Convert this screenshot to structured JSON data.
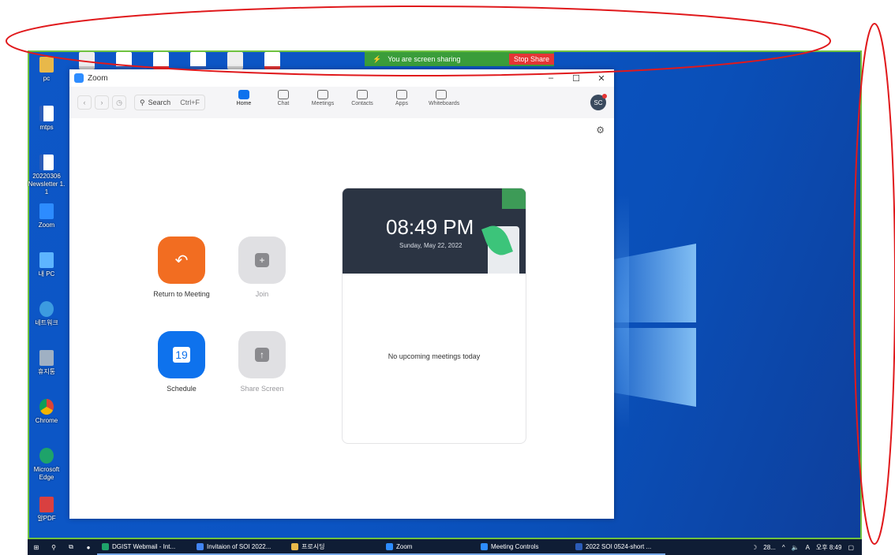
{
  "desktop_icons": [
    {
      "label": "pc",
      "icon": "folder-icon",
      "type": "folder"
    },
    {
      "label": "mtps",
      "icon": "word-document-icon",
      "type": "doc"
    },
    {
      "label": "20220306\nNewsletter 1. 1",
      "icon": "word-document-icon",
      "type": "doc"
    },
    {
      "label": "Zoom",
      "icon": "zoom-icon",
      "type": "zoom"
    },
    {
      "label": "내 PC",
      "icon": "computer-icon",
      "type": "pc"
    },
    {
      "label": "네트워크",
      "icon": "network-icon",
      "type": "net"
    },
    {
      "label": "휴지통",
      "icon": "recycle-bin-icon",
      "type": "bin"
    },
    {
      "label": "Chrome",
      "icon": "chrome-icon",
      "type": "chrome"
    },
    {
      "label": "Microsoft Edge",
      "icon": "edge-icon",
      "type": "edge"
    },
    {
      "label": "알PDF",
      "icon": "pdf-app-icon",
      "type": "app"
    }
  ],
  "share_bar": {
    "text": "You are screen sharing",
    "stop_label": "Stop Share"
  },
  "zoom": {
    "title": "Zoom",
    "search": {
      "label": "Search",
      "shortcut": "Ctrl+F"
    },
    "tabs": [
      {
        "label": "Home",
        "icon": "home-icon",
        "active": true
      },
      {
        "label": "Chat",
        "icon": "chat-icon",
        "active": false
      },
      {
        "label": "Meetings",
        "icon": "clock-icon",
        "active": false
      },
      {
        "label": "Contacts",
        "icon": "contacts-icon",
        "active": false
      },
      {
        "label": "Apps",
        "icon": "apps-icon",
        "active": false
      },
      {
        "label": "Whiteboards",
        "icon": "whiteboard-icon",
        "active": false
      }
    ],
    "avatar_initials": "SC",
    "actions": {
      "return": "Return to Meeting",
      "join": "Join",
      "schedule": "Schedule",
      "schedule_day": "19",
      "share": "Share Screen"
    },
    "clock": {
      "time": "08:49 PM",
      "date": "Sunday, May 22, 2022"
    },
    "no_meetings": "No upcoming meetings today"
  },
  "taskbar": {
    "items": [
      {
        "label": "DGIST Webmail - Int...",
        "icon": "edge-icon"
      },
      {
        "label": "Invitaion of SOI 2022...",
        "icon": "chrome-icon"
      },
      {
        "label": "프로시딩",
        "icon": "folder-icon"
      },
      {
        "label": "Zoom",
        "icon": "zoom-icon"
      },
      {
        "label": "Meeting Controls",
        "icon": "zoom-icon"
      },
      {
        "label": "2022 SOI 0524-short ...",
        "icon": "word-icon"
      }
    ],
    "tray": {
      "weather": "28...",
      "lang": "A",
      "time": "오후 8:49"
    }
  },
  "colors": {
    "zoom_blue": "#0e72ed",
    "return_orange": "#f26d21",
    "annotation_red": "#e0191c",
    "share_green": "#3a9d3a"
  }
}
